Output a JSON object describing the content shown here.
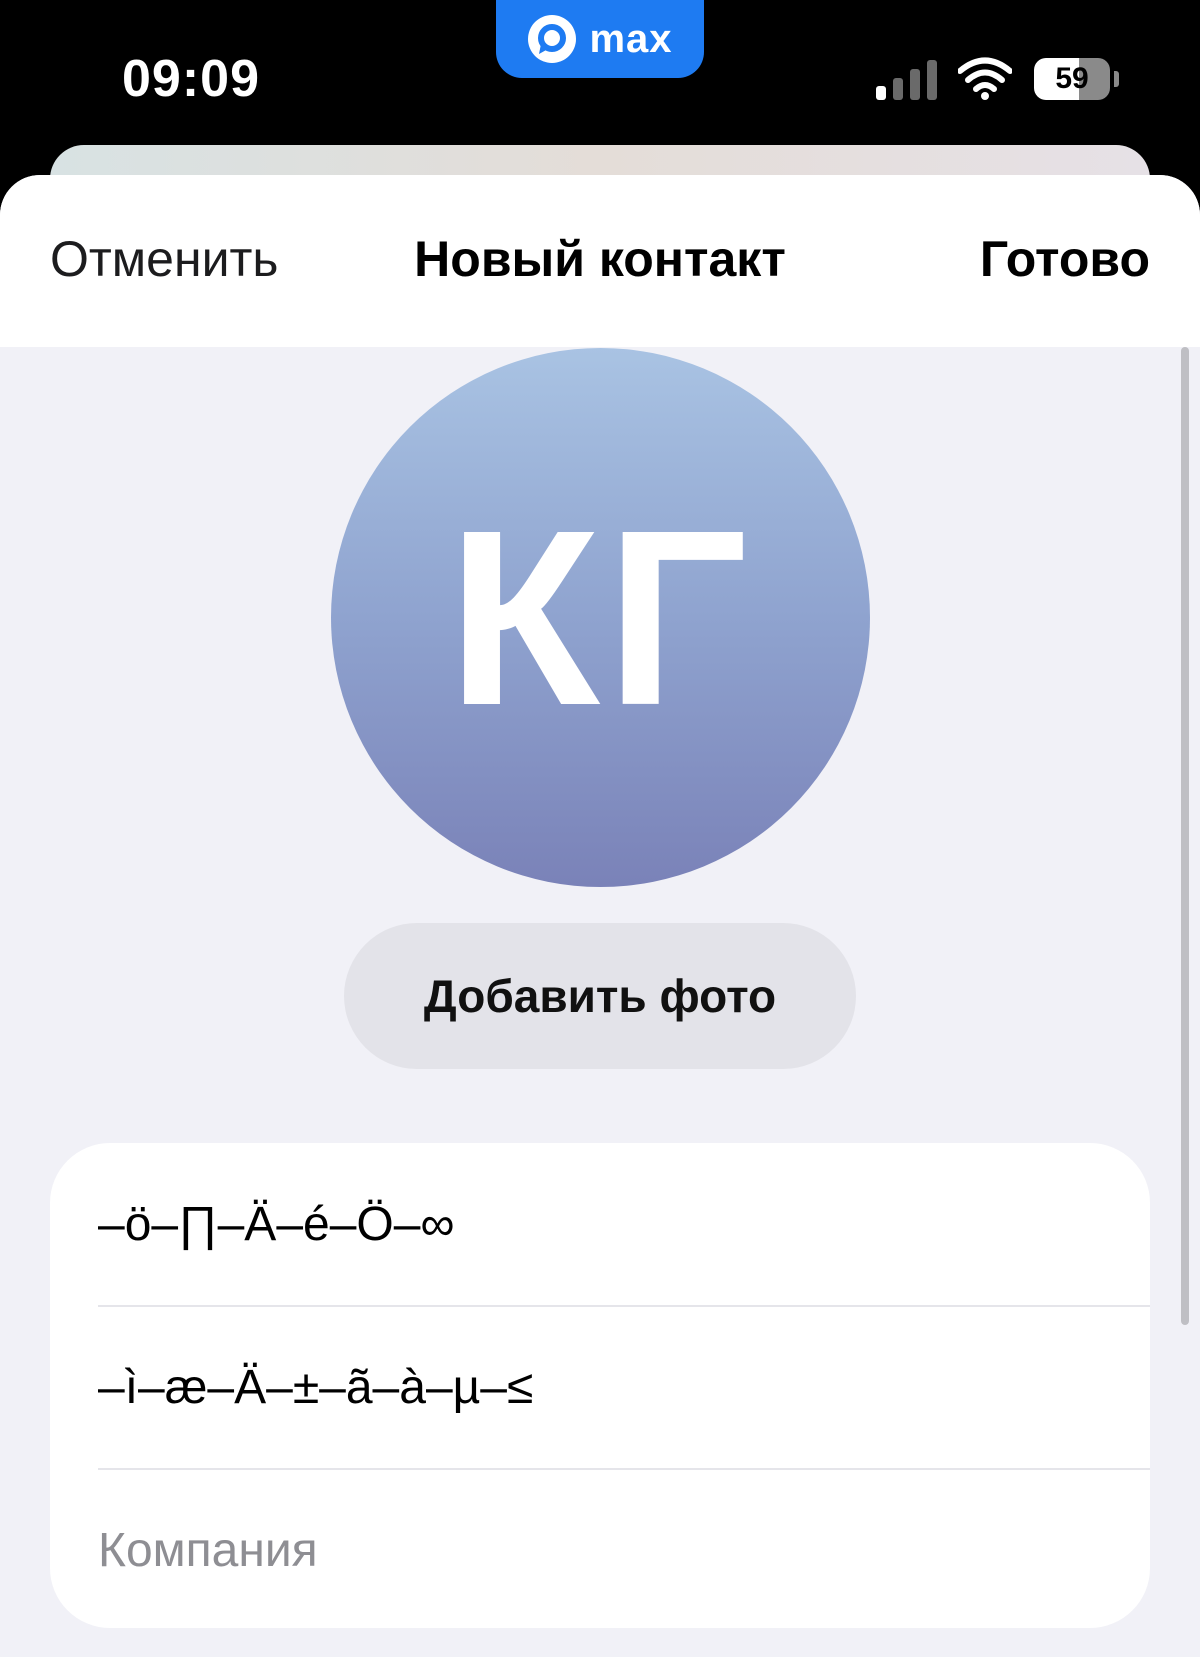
{
  "status_bar": {
    "time": "09:09",
    "app_name": "max",
    "battery": "59",
    "battery_level": 0.59,
    "icons": [
      "signal-icon",
      "wifi-icon",
      "battery-icon",
      "max-logo-icon"
    ]
  },
  "nav": {
    "cancel_label": "Отменить",
    "title": "Новый контакт",
    "done_label": "Готово"
  },
  "avatar": {
    "initials": "КГ",
    "gradient_top": "#a9c3e3",
    "gradient_bottom": "#7a82b8"
  },
  "add_photo_label": "Добавить фото",
  "form": {
    "fields": [
      {
        "value": "–ö–∏–Ä–é–Ö–∞",
        "placeholder": ""
      },
      {
        "value": "–ì–æ–Ä–±–ã–à–µ–≤",
        "placeholder": ""
      },
      {
        "value": "",
        "placeholder": "Компания"
      }
    ]
  },
  "colors": {
    "accent": "#1e7bf2",
    "sheet_bg": "#f1f1f7",
    "card_bg": "#ffffff",
    "button_bg": "#e3e3e9",
    "placeholder": "#8e8e93"
  }
}
